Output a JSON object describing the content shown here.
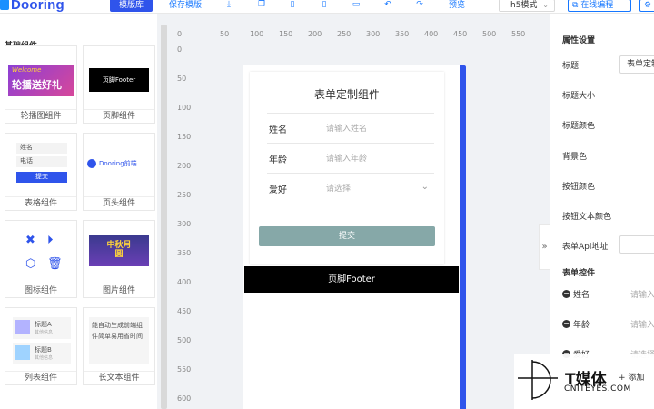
{
  "app": {
    "logo": "Dooring"
  },
  "toolbar": {
    "template_lib": "模版库",
    "save_template": "保存模版",
    "preview": "预览",
    "mode_select": "h5模式",
    "online_code": "在线编程"
  },
  "left_panel": {
    "title": "基础组件",
    "cards": [
      {
        "label": "轮播图组件",
        "thumb_text": "轮播送好礼",
        "thumb_sub": "Welcome"
      },
      {
        "label": "页脚组件",
        "thumb_text": "页脚Footer"
      },
      {
        "label": "表格组件",
        "thumb_field1": "姓名",
        "thumb_field2": "电话",
        "thumb_btn": "提交"
      },
      {
        "label": "页头组件",
        "thumb_text": "Dooring前端"
      },
      {
        "label": "图标组件"
      },
      {
        "label": "图片组件",
        "thumb_text": "中秋月圆"
      },
      {
        "label": "列表组件",
        "thumb_item1": "标题A",
        "thumb_item2": "标题B",
        "thumb_sub": "其他信息"
      },
      {
        "label": "长文本组件",
        "thumb_text": "能自动生成前端组件简单易用省时间"
      }
    ]
  },
  "ruler": {
    "h_ticks": [
      "0",
      "50",
      "100",
      "150",
      "200",
      "250",
      "300",
      "350",
      "400",
      "450",
      "500",
      "550"
    ],
    "v_ticks": [
      "0",
      "50",
      "100",
      "150",
      "200",
      "250",
      "300",
      "350",
      "400",
      "450",
      "500",
      "550",
      "600"
    ]
  },
  "canvas": {
    "form_title": "表单定制组件",
    "fields": [
      {
        "label": "姓名",
        "placeholder": "请输入姓名"
      },
      {
        "label": "年龄",
        "placeholder": "请输入年龄"
      },
      {
        "label": "爱好",
        "placeholder": "请选择",
        "chevron": true
      }
    ],
    "submit_label": "提交",
    "footer_text": "页脚Footer",
    "submit_color": "#86a8a8",
    "accent_color": "#2f54eb"
  },
  "right_panel": {
    "title": "属性设置",
    "props": [
      {
        "label": "标题",
        "value": "表单定制组件"
      },
      {
        "label": "标题大小"
      },
      {
        "label": "标题颜色"
      },
      {
        "label": "背景色"
      },
      {
        "label": "按钮颜色"
      },
      {
        "label": "按钮文本颜色"
      },
      {
        "label": "表单Api地址",
        "value": ""
      }
    ],
    "controls_title": "表单控件",
    "controls": [
      {
        "label": "姓名",
        "placeholder": "请输入"
      },
      {
        "label": "年龄",
        "placeholder": "请输入"
      },
      {
        "label": "爱好",
        "placeholder": "请选择"
      }
    ],
    "add_label": "添加"
  },
  "watermark": {
    "brand": "T媒体",
    "url": "CNITEYES.COM"
  }
}
